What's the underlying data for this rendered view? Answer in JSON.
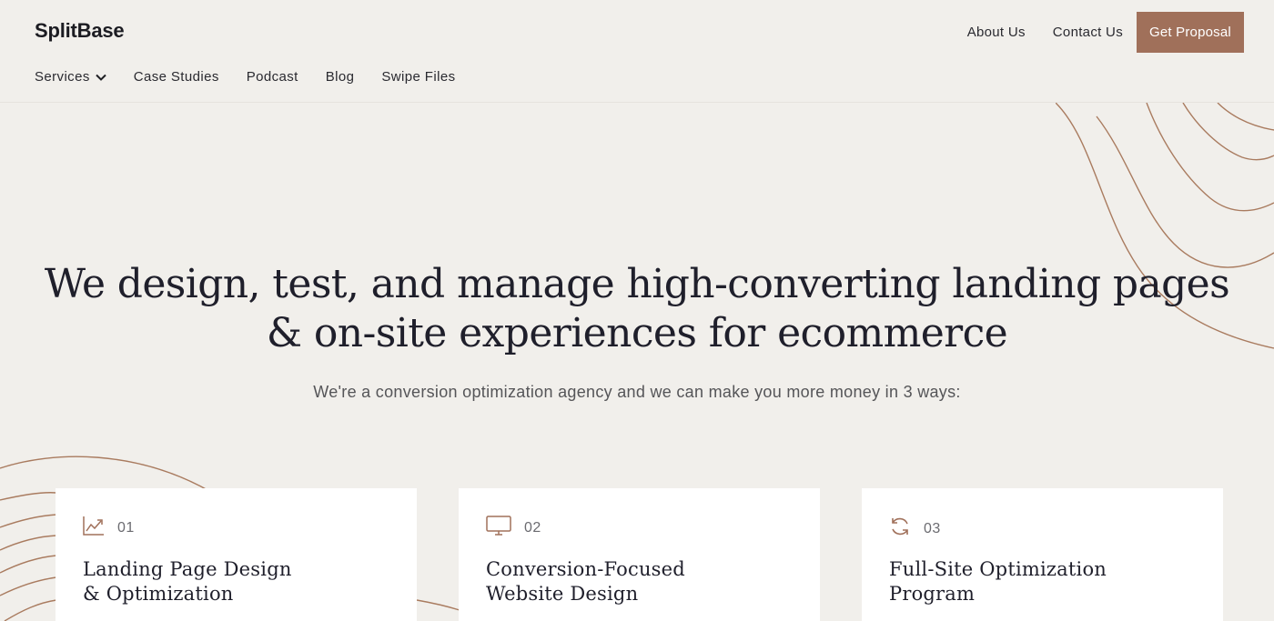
{
  "header": {
    "logo": "SplitBase",
    "top_links": [
      "About Us",
      "Contact Us"
    ],
    "cta_label": "Get Proposal",
    "nav": [
      {
        "label": "Services",
        "icon": "chevron-down-icon"
      },
      {
        "label": "Case Studies"
      },
      {
        "label": "Podcast"
      },
      {
        "label": "Blog"
      },
      {
        "label": "Swipe Files"
      }
    ]
  },
  "hero": {
    "headline_line1": "We design, test, and manage high-converting landing pages",
    "headline_line2": "& on-site experiences for ecommerce",
    "subheadline": "We're a conversion optimization agency and we can make you more money in 3 ways:"
  },
  "services": [
    {
      "number": "01",
      "icon": "chart-growth-icon",
      "title_line1": "Landing Page Design",
      "title_line2": "& Optimization"
    },
    {
      "number": "02",
      "icon": "monitor-icon",
      "title_line1": "Conversion-Focused",
      "title_line2": "Website Design"
    },
    {
      "number": "03",
      "icon": "refresh-icon",
      "title_line1": "Full-Site Optimization",
      "title_line2": "Program"
    }
  ],
  "colors": {
    "background": "#f1efeb",
    "accent": "#a0705a",
    "text": "#1f1f2b",
    "card": "#ffffff"
  }
}
